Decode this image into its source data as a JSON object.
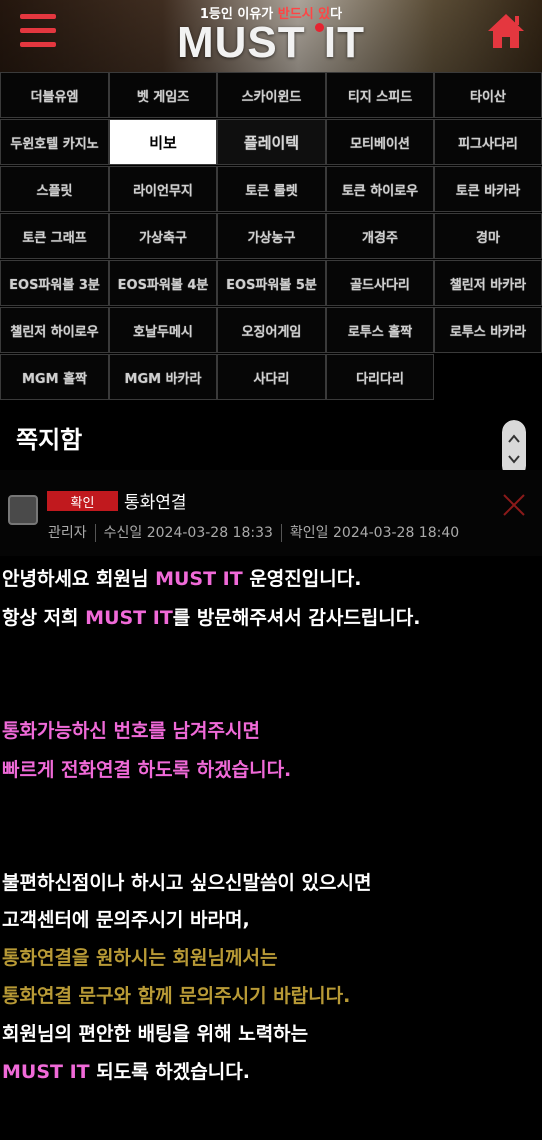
{
  "header": {
    "tagline_prefix": "1등인 이유가 ",
    "tagline_highlight": "반드시 있",
    "tagline_suffix": "다",
    "logo_part1": "MUST",
    "logo_part2": "IT",
    "accent_color": "#e4373f"
  },
  "games": [
    [
      "더블유엠",
      "벳 게임즈",
      "스카이윈드",
      "티지 스피드",
      "타이산"
    ],
    [
      "두윈호텔 카지노",
      "비보",
      "플레이텍",
      "모티베이션",
      "피그사다리"
    ],
    [
      "스플릿",
      "라이언무지",
      "토큰 룰렛",
      "토큰 하이로우",
      "토큰 바카라"
    ],
    [
      "토큰 그래프",
      "가상축구",
      "가상농구",
      "개경주",
      "경마"
    ],
    [
      "EOS파워볼 3분",
      "EOS파워볼 4분",
      "EOS파워볼 5분",
      "골드사다리",
      "챌린저 바카라"
    ],
    [
      "챌린저 하이로우",
      "호날두메시",
      "오징어게임",
      "로투스 홀짝",
      "로투스 바카라"
    ],
    [
      "MGM 홀짝",
      "MGM 바카라",
      "사다리",
      "다리다리"
    ]
  ],
  "active_game": "비보",
  "message_box": {
    "title": "쪽지함",
    "badge": "확인",
    "subject": "통화연결",
    "sender": "관리자",
    "received_label": "수신일",
    "received_at": "2024-03-28 18:33",
    "read_label": "확인일",
    "read_at": "2024-03-28 18:40"
  },
  "message_body": {
    "l1_a": "안녕하세요 회원님 ",
    "l1_b": "MUST IT",
    "l1_c": " 운영진입니다.",
    "l2_a": "항상 저희 ",
    "l2_b": "MUST IT",
    "l2_c": "를 방문해주셔서 감사드립니다.",
    "l3": "통화가능하신 번호를 남겨주시면",
    "l4": "빠르게 전화연결 하도록 하겠습니다.",
    "l5": "불편하신점이나 하시고 싶으신말씀이 있으시면",
    "l6": "고객센터에 문의주시기 바라며,",
    "l7": "통화연결을 원하시는 회원님께서는",
    "l8": "통화연결 문구와 함께 문의주시기 바랍니다.",
    "l9": "회원님의 편안한 배팅을 위해 노력하는",
    "l10_a": "MUST IT",
    "l10_b": " 되도록 하겠습니다."
  }
}
